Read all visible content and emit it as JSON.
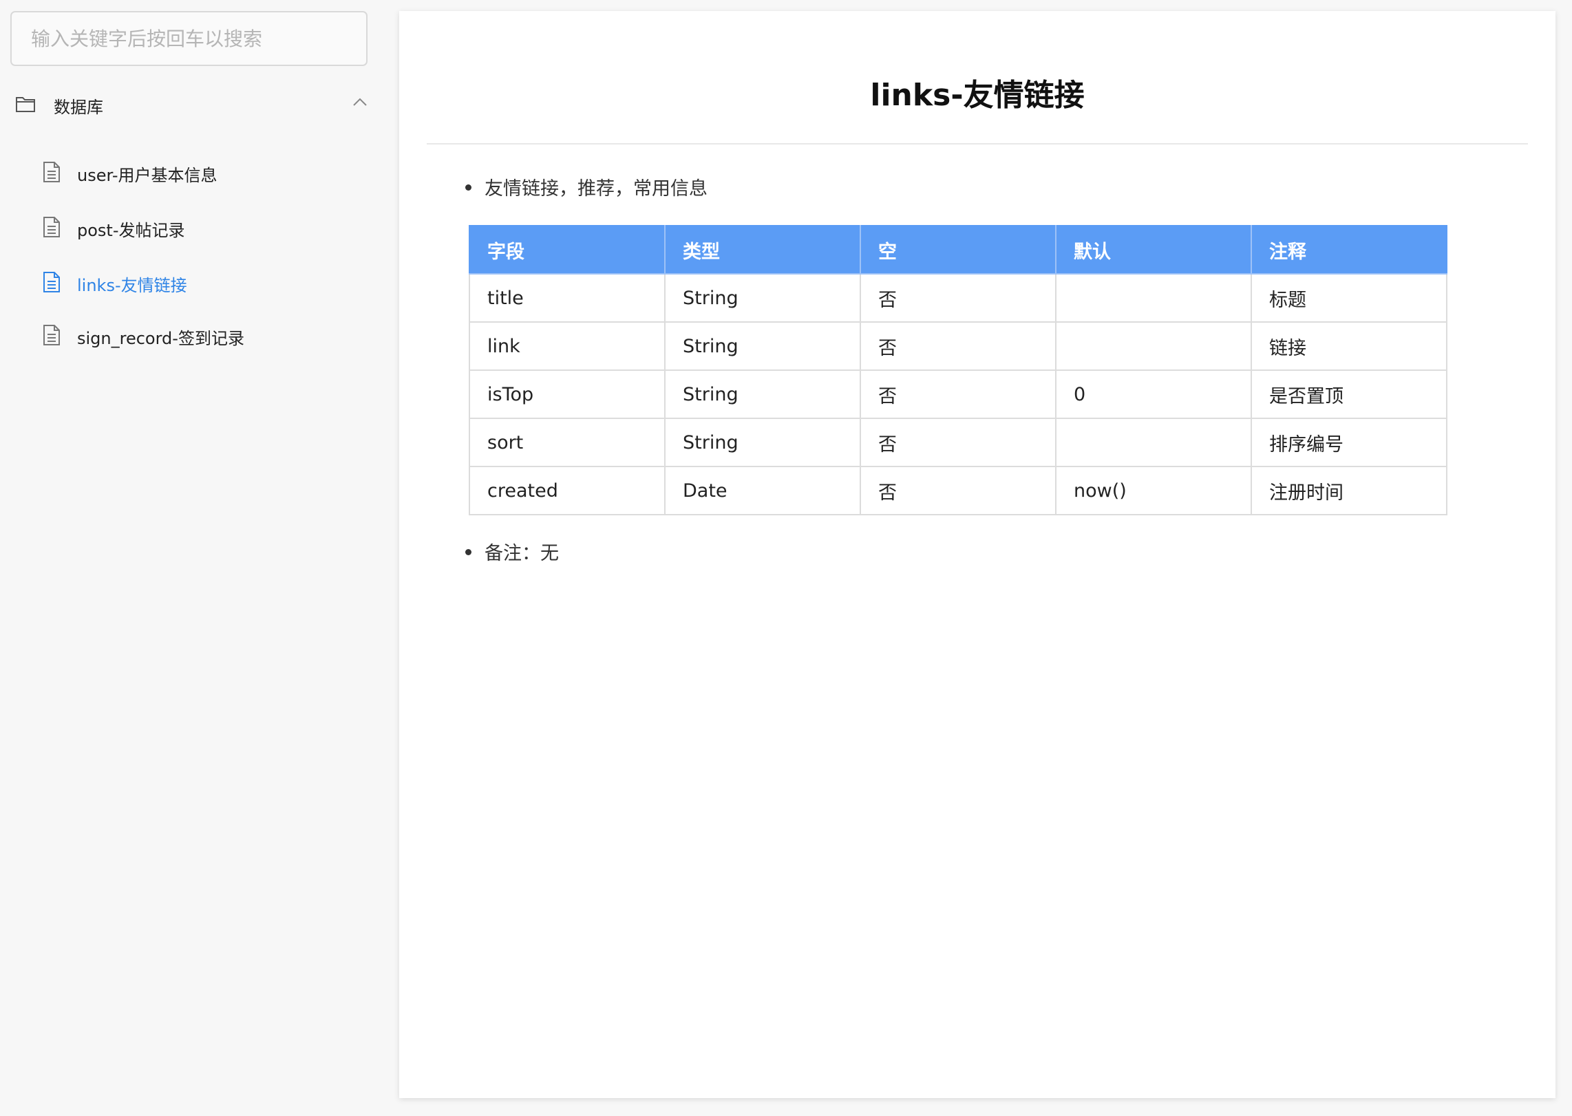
{
  "search": {
    "placeholder": "输入关键字后按回车以搜索"
  },
  "sidebar": {
    "folder": {
      "label": "数据库",
      "icon": "folder-icon"
    },
    "items": [
      {
        "label": "user-用户基本信息",
        "icon": "document-icon"
      },
      {
        "label": "post-发帖记录",
        "icon": "document-icon"
      },
      {
        "label": "links-友情链接",
        "icon": "document-icon",
        "active": true
      },
      {
        "label": "sign_record-签到记录",
        "icon": "document-icon"
      }
    ]
  },
  "main": {
    "title": "links-友情链接",
    "description": "友情链接，推荐，常用信息",
    "table": {
      "headers": [
        "字段",
        "类型",
        "空",
        "默认",
        "注释"
      ],
      "rows": [
        [
          "title",
          "String",
          "否",
          "",
          "标题"
        ],
        [
          "link",
          "String",
          "否",
          "",
          "链接"
        ],
        [
          "isTop",
          "String",
          "否",
          "0",
          "是否置顶"
        ],
        [
          "sort",
          "String",
          "否",
          "",
          "排序编号"
        ],
        [
          "created",
          "Date",
          "否",
          "now()",
          "注册时间"
        ]
      ]
    },
    "note": "备注：无"
  },
  "colors": {
    "accent": "#2f84e6",
    "table_header": "#5b9cf5"
  }
}
